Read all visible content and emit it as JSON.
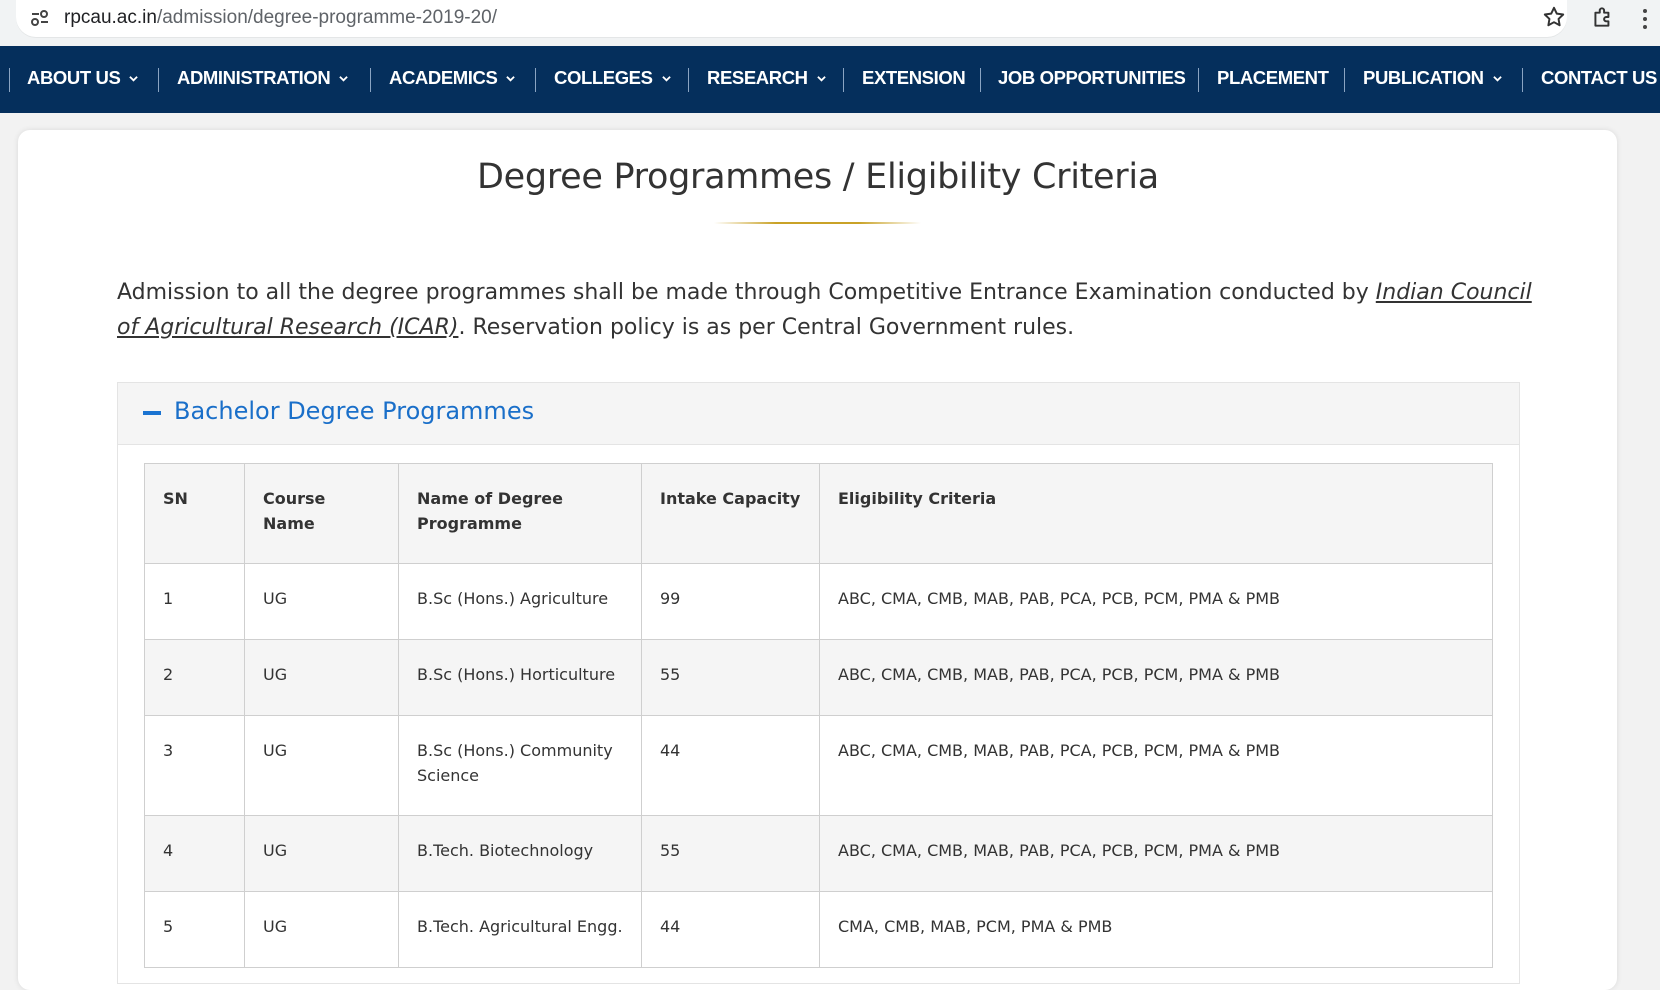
{
  "browser": {
    "url_host": "rpcau.ac.in",
    "url_path": "/admission/degree-programme-2019-20/"
  },
  "nav": {
    "items": [
      {
        "label": "ABOUT US",
        "dropdown": true
      },
      {
        "label": "ADMINISTRATION",
        "dropdown": true
      },
      {
        "label": "ACADEMICS",
        "dropdown": true
      },
      {
        "label": "COLLEGES",
        "dropdown": true
      },
      {
        "label": "RESEARCH",
        "dropdown": true
      },
      {
        "label": "EXTENSION",
        "dropdown": false
      },
      {
        "label": "JOB OPPORTUNITIES",
        "dropdown": false
      },
      {
        "label": "PLACEMENT",
        "dropdown": false
      },
      {
        "label": "PUBLICATION",
        "dropdown": true
      },
      {
        "label": "CONTACT US",
        "dropdown": false
      }
    ]
  },
  "page": {
    "title": "Degree Programmes / Eligibility Criteria",
    "intro_before": "Admission to all the degree programmes shall be made through Competitive Entrance Examination conducted by ",
    "intro_link": "Indian Council of Agricultural Research (ICAR)",
    "intro_after": ". Reservation policy is as per Central Government rules."
  },
  "accordion": {
    "title": "Bachelor Degree Programmes",
    "expanded": true
  },
  "table": {
    "headers": {
      "sn": "SN",
      "course": "Course Name",
      "degree": "Name of Degree Programme",
      "intake": "Intake Capacity",
      "eligibility": "Eligibility Criteria"
    },
    "rows": [
      {
        "sn": "1",
        "course": "UG",
        "degree": "B.Sc (Hons.) Agriculture",
        "intake": "99",
        "eligibility": "ABC, CMA, CMB, MAB, PAB, PCA, PCB, PCM, PMA & PMB"
      },
      {
        "sn": "2",
        "course": "UG",
        "degree": "B.Sc (Hons.) Horticulture",
        "intake": "55",
        "eligibility": "ABC, CMA, CMB, MAB, PAB, PCA, PCB, PCM, PMA & PMB"
      },
      {
        "sn": "3",
        "course": "UG",
        "degree": "B.Sc (Hons.) Community Science",
        "intake": "44",
        "eligibility": "ABC, CMA, CMB, MAB, PAB, PCA, PCB, PCM, PMA & PMB"
      },
      {
        "sn": "4",
        "course": "UG",
        "degree": "B.Tech. Biotechnology",
        "intake": "55",
        "eligibility": "ABC, CMA, CMB, MAB, PAB, PCA, PCB, PCM, PMA & PMB"
      },
      {
        "sn": "5",
        "course": "UG",
        "degree": "B.Tech. Agricultural Engg.",
        "intake": "44",
        "eligibility": "CMA, CMB, MAB, PCM, PMA & PMB"
      }
    ]
  },
  "colors": {
    "nav_bg": "#052f5c",
    "accent_blue": "#1a6fc9",
    "title_rule_gold": "#c9a227"
  }
}
